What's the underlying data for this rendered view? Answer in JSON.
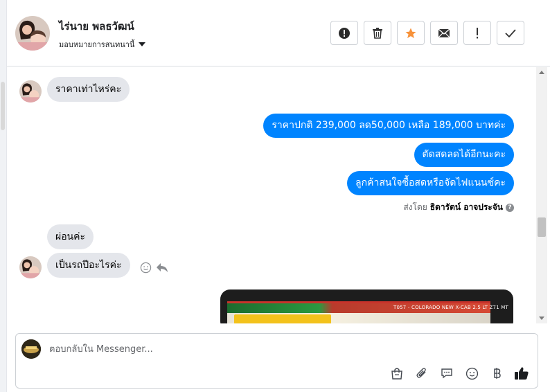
{
  "header": {
    "contact_name": "ไร่นาย พลธวัฒน์",
    "assign_label": "มอบหมายการสนทนานี้",
    "actions": [
      {
        "name": "report-button",
        "glyph": "!"
      },
      {
        "name": "delete-button",
        "glyph": "🗑"
      },
      {
        "name": "star-button",
        "glyph": "★"
      },
      {
        "name": "mark-unread-button",
        "glyph": "✉"
      },
      {
        "name": "follow-up-button",
        "glyph": "!"
      },
      {
        "name": "done-button",
        "glyph": "✓"
      }
    ]
  },
  "messages": {
    "incoming_1": "ราคาเท่าไหร่คะ",
    "outgoing_1": "ราคาปกติ 239,000 ลด50,000 เหลือ 189,000 บาทค่ะ",
    "outgoing_2": "ตัดสดลดได้อีกนะคะ",
    "outgoing_3": "ลูกค้าสนใจซื้อสดหรือจัดไฟแนนซ์คะ",
    "sent_by_prefix": "ส่งโดย",
    "sent_by_name": "ธิดารัตน์ อาจประจัน",
    "incoming_2": "ผ่อนค่ะ",
    "incoming_3": "เป็นรถปีอะไรค่ะ",
    "image_caption": "T057 - COLORADO NEW X-CAB 2.5 LT Z71 MT"
  },
  "composer": {
    "placeholder": "ตอบกลับใน Messenger..."
  },
  "colors": {
    "outgoing_bubble": "#0084ff",
    "incoming_bubble": "#e4e6eb",
    "star": "#f7923a"
  }
}
